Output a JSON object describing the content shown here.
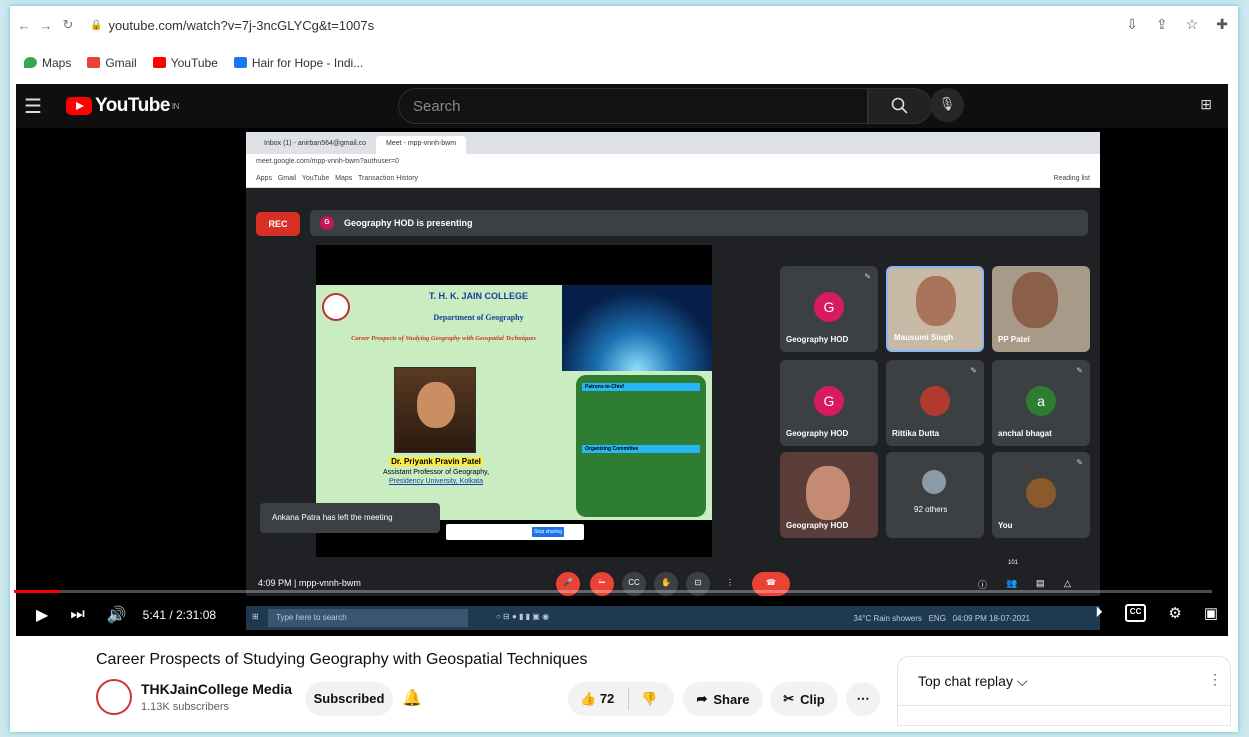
{
  "browser": {
    "url": "youtube.com/watch?v=7j-3ncGLYCg&t=1007s",
    "bookmarks": [
      "Maps",
      "Gmail",
      "YouTube",
      "Hair for Hope - Indi..."
    ]
  },
  "youtube": {
    "logo": "YouTube",
    "region": "IN",
    "search_placeholder": "Search"
  },
  "meet": {
    "tabs": [
      "Inbox (1) - anirban564@gmail.co",
      "Meet - mpp-vnnh-bwm"
    ],
    "url": "meet.google.com/mpp-vnnh-bwm?authuser=0",
    "bookmarks": [
      "Apps",
      "Gmail",
      "YouTube",
      "Maps",
      "Transaction History"
    ],
    "reading_list": "Reading list",
    "rec": "REC",
    "presenting": "Geography HOD is presenting",
    "presenter_initial": "G",
    "toast": "Ankana Patra has left the meeting",
    "share_btn": "Stop sharing",
    "time": "4:09 PM",
    "sep": "|",
    "code": "mpp-vnnh-bwm",
    "count": "101",
    "participants": [
      {
        "name": "Geography HOD",
        "initial": "G"
      },
      {
        "name": "Mausumi Singh"
      },
      {
        "name": "PP Patel"
      },
      {
        "name": "Geography HOD",
        "initial": "G"
      },
      {
        "name": "Rittika Dutta"
      },
      {
        "name": "anchal bhagat",
        "initial": "a"
      },
      {
        "name": "Geography HOD"
      },
      {
        "name": "92 others"
      },
      {
        "name": "You"
      }
    ]
  },
  "slide": {
    "college": "T. H. K. JAIN COLLEGE",
    "dept": "Department of Geography",
    "topic": "Career Prospects of Studying Geography with Geospatial Techniques",
    "speaker": "Dr. Priyank Pravin Patel",
    "role": "Assistant Professor of Geography,",
    "univ": "Presidency University, Kolkata",
    "patrons_head": "Patrons-in-Chief",
    "committee_head": "Organizing Committee"
  },
  "taskbar": {
    "search": "Type here to search",
    "weather": "34°C Rain showers",
    "lang": "ENG",
    "time": "04:09 PM",
    "date": "18-07-2021"
  },
  "player": {
    "time": "5:41 / 2:31:08",
    "progress": 0.038
  },
  "video": {
    "title": "Career Prospects of Studying Geography with Geospatial Techniques",
    "channel": "THKJainCollege Media",
    "subscribers": "1.13K subscribers",
    "subscribed": "Subscribed",
    "likes": "72",
    "share": "Share",
    "clip": "Clip",
    "more": "⋯"
  },
  "chat": {
    "title": "Top chat replay"
  }
}
